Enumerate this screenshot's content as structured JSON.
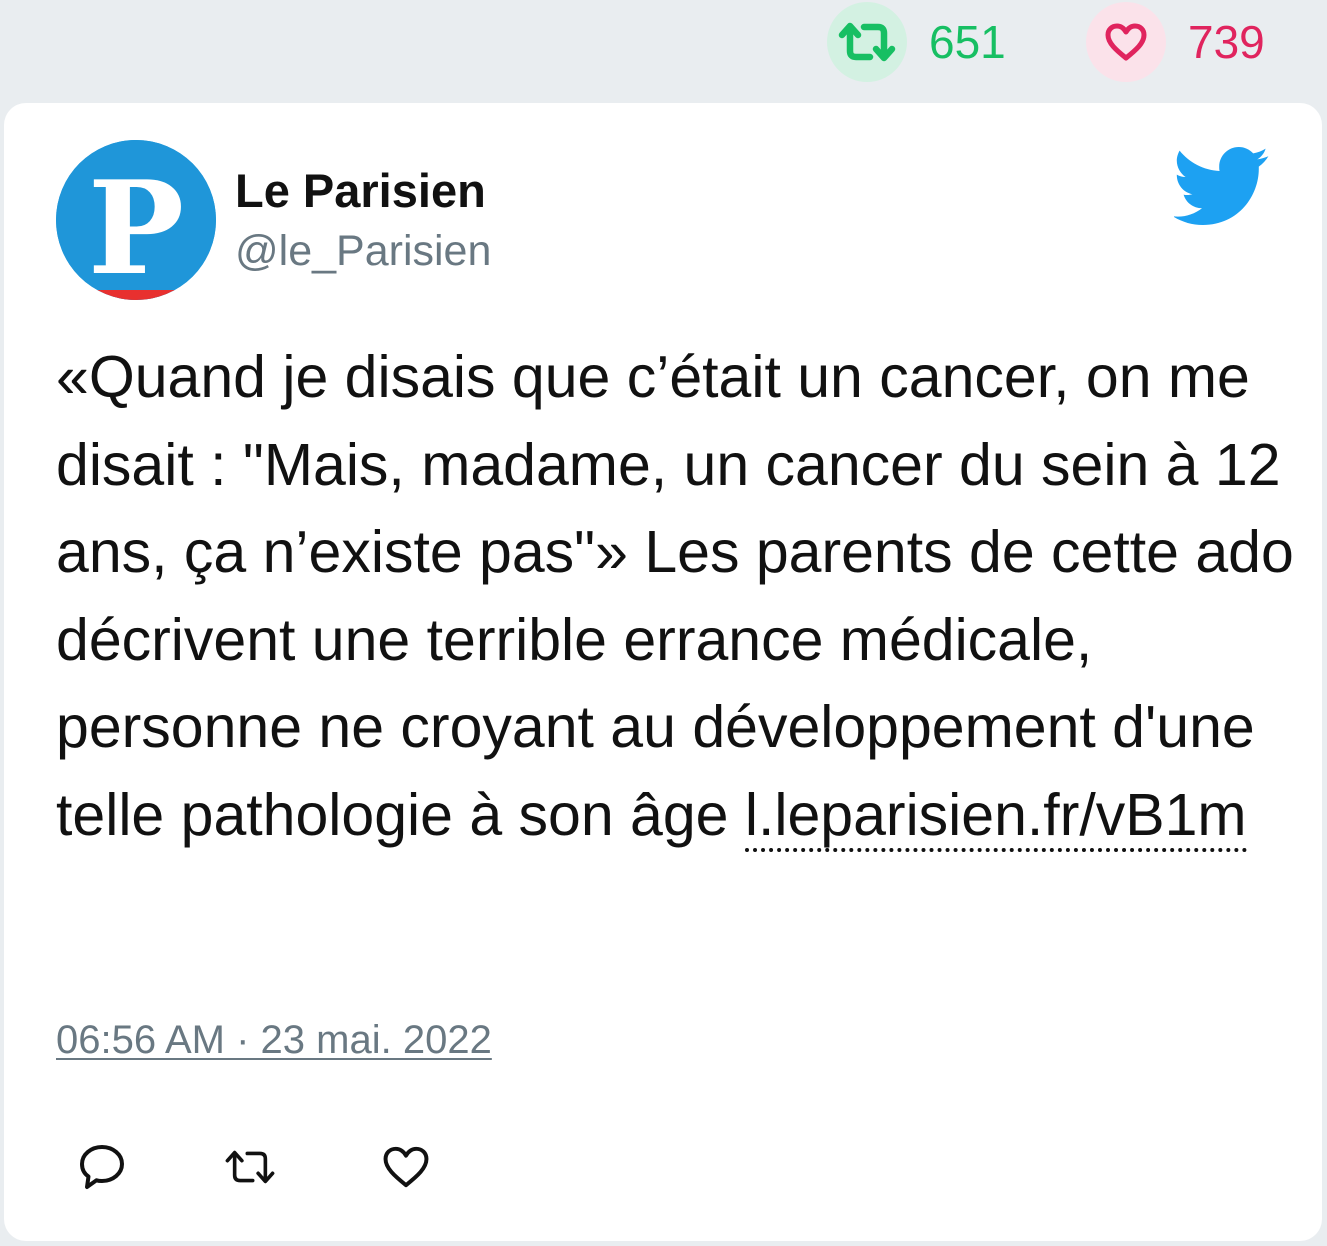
{
  "stats": {
    "retweets": {
      "count": "651",
      "icon": "retweet-icon",
      "color": "#17bf63"
    },
    "likes": {
      "count": "739",
      "icon": "heart-icon",
      "color": "#e0245e"
    }
  },
  "tweet": {
    "author": {
      "name": "Le Parisien",
      "handle": "@le_Parisien",
      "avatar_letter": "P"
    },
    "text": "«Quand je disais que c’était un cancer, on me disait : \"Mais, madame, un cancer du sein à 12 ans, ça n’existe pas\"» Les parents de cette ado décrivent une terrible errance médicale, personne ne croyant au développement d'une telle pathologie à son âge ",
    "link": "l.leparisien.fr/vB1m",
    "timestamp": "06:56 AM · 23 mai. 2022",
    "platform_icon": "twitter-bird-icon",
    "brand_color": "#1da1f2"
  },
  "actions": [
    {
      "name": "reply",
      "icon": "reply-icon"
    },
    {
      "name": "retweet",
      "icon": "retweet-icon"
    },
    {
      "name": "like",
      "icon": "heart-icon"
    }
  ]
}
